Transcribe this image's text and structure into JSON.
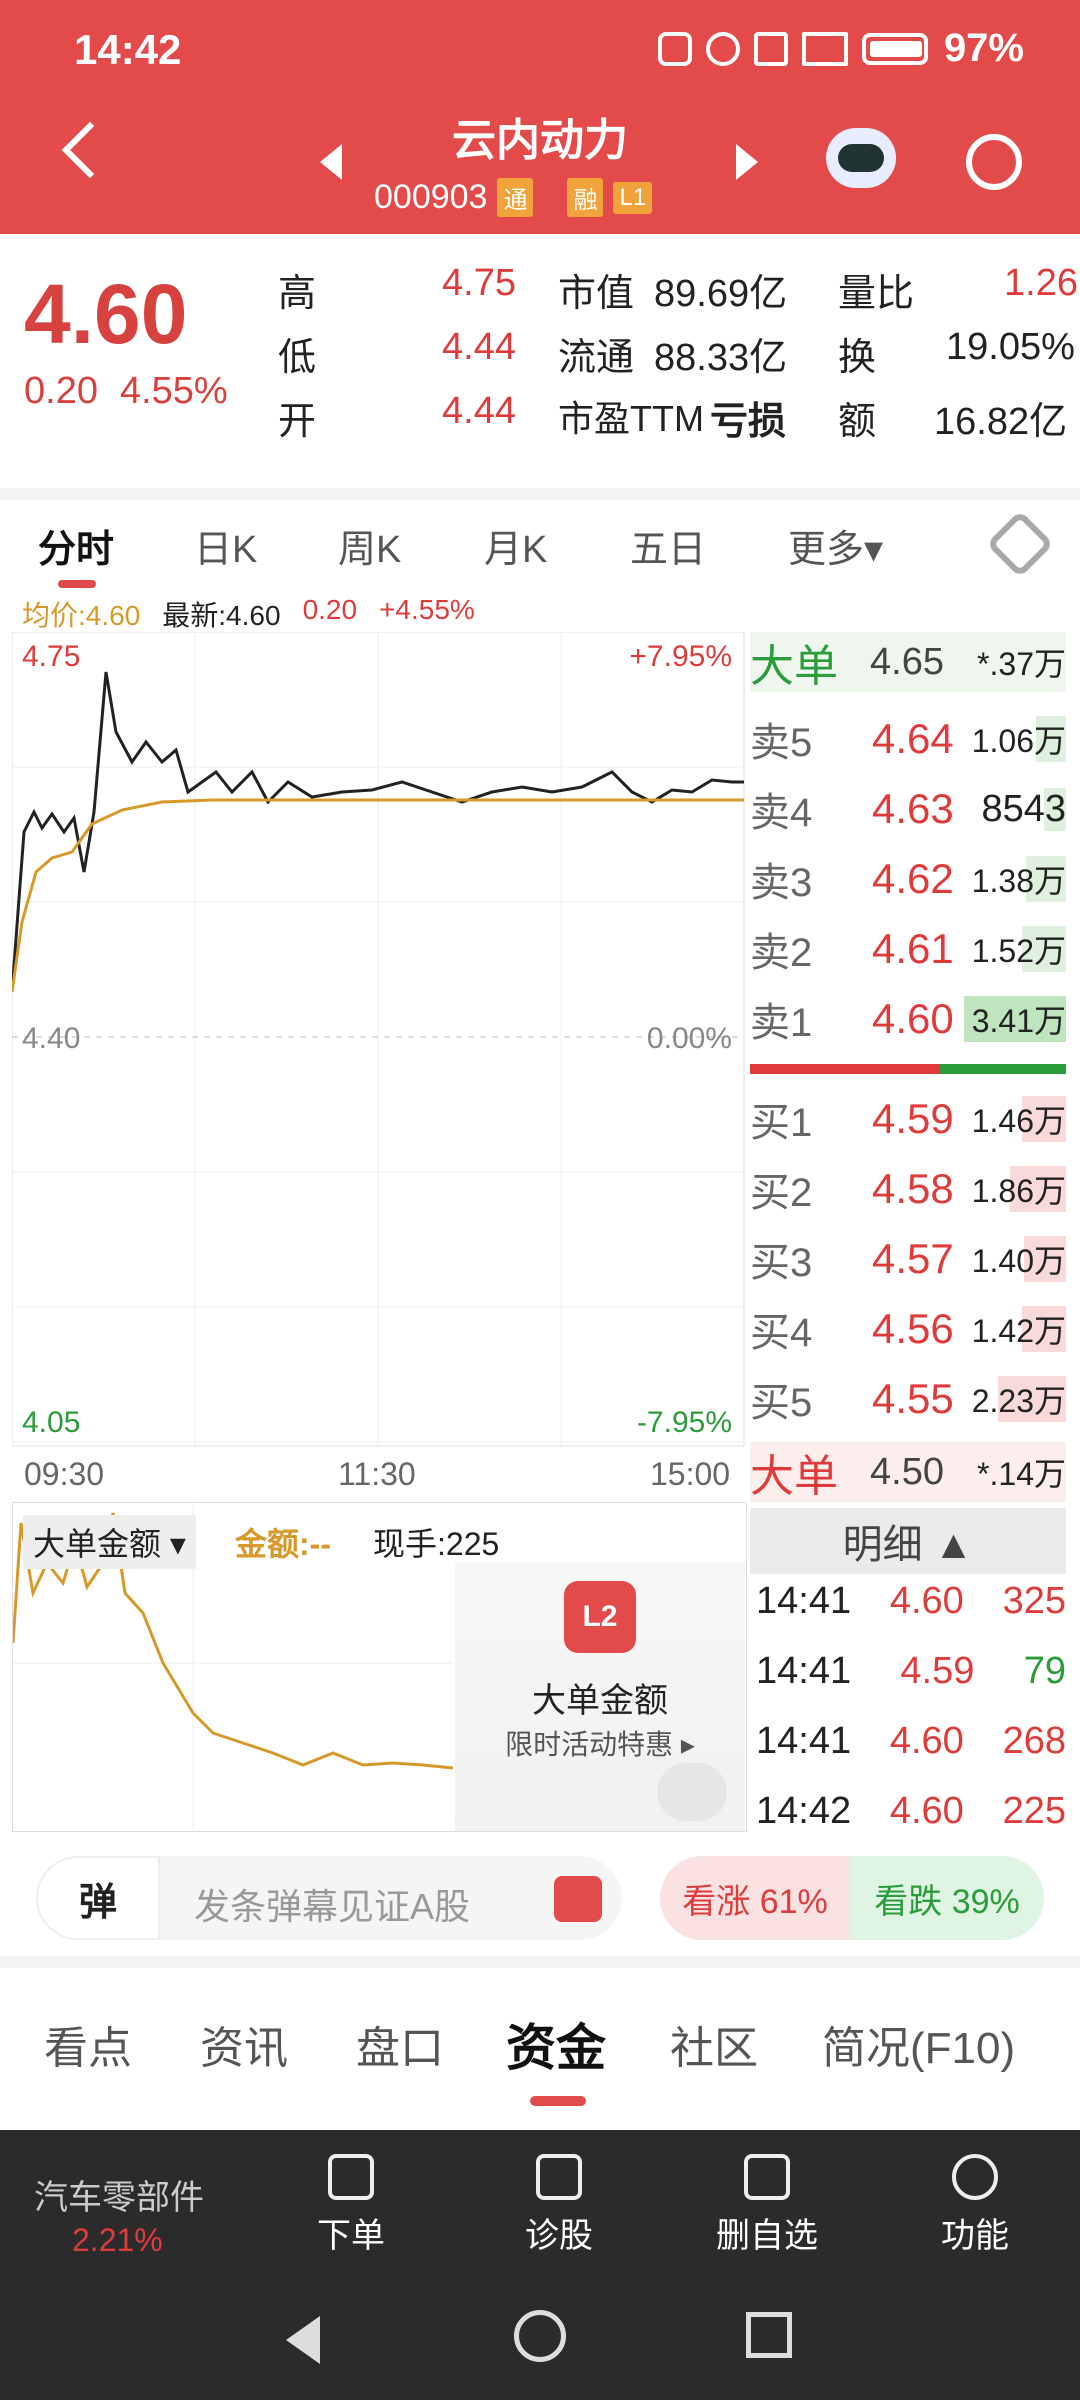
{
  "status": {
    "time": "14:42",
    "battery": "97%"
  },
  "header": {
    "title": "云内动力",
    "code": "000903",
    "tags": [
      "通",
      "融",
      "L1"
    ]
  },
  "quote": {
    "price": "4.60",
    "change": "0.20",
    "change_pct": "4.55%",
    "high_label": "高",
    "high": "4.75",
    "low_label": "低",
    "low": "4.44",
    "open_label": "开",
    "open": "4.44",
    "mktcap_label": "市值",
    "mktcap": "89.69亿",
    "float_label": "流通",
    "float": "88.33亿",
    "pe_label": "市盈TTM",
    "pe": "亏损",
    "vol_ratio_label": "量比",
    "vol_ratio": "1.26",
    "turnover_label": "换",
    "turnover": "19.05%",
    "amount_label": "额",
    "amount": "16.82亿"
  },
  "tabs": [
    "分时",
    "日K",
    "周K",
    "月K",
    "五日",
    "更多▾"
  ],
  "avg_line": {
    "avg": "均价:4.60",
    "latest": "最新:4.60",
    "chg": "0.20",
    "pct": "+4.55%"
  },
  "chart": {
    "y_top": "4.75",
    "y_mid": "4.40",
    "y_bot": "4.05",
    "pct_top": "+7.95%",
    "pct_mid": "0.00%",
    "pct_bot": "-7.95%",
    "x_labels": [
      "09:30",
      "11:30",
      "15:00"
    ]
  },
  "depth": {
    "big_top": {
      "label": "大单",
      "price": "4.65",
      "qty": "*.37万"
    },
    "asks": [
      {
        "label": "卖5",
        "price": "4.64",
        "qty": "1.06万"
      },
      {
        "label": "卖4",
        "price": "4.63",
        "qty": "8543"
      },
      {
        "label": "卖3",
        "price": "4.62",
        "qty": "1.38万"
      },
      {
        "label": "卖2",
        "price": "4.61",
        "qty": "1.52万"
      },
      {
        "label": "卖1",
        "price": "4.60",
        "qty": "3.41万"
      }
    ],
    "bids": [
      {
        "label": "买1",
        "price": "4.59",
        "qty": "1.46万"
      },
      {
        "label": "买2",
        "price": "4.58",
        "qty": "1.86万"
      },
      {
        "label": "买3",
        "price": "4.57",
        "qty": "1.40万"
      },
      {
        "label": "买4",
        "price": "4.56",
        "qty": "1.42万"
      },
      {
        "label": "买5",
        "price": "4.55",
        "qty": "2.23万"
      }
    ],
    "big_bottom": {
      "label": "大单",
      "price": "4.50",
      "qty": "*.14万"
    }
  },
  "detail": {
    "header": "明细 ▲",
    "rows": [
      {
        "time": "14:41",
        "price": "4.60",
        "qty": "325"
      },
      {
        "time": "14:41",
        "price": "4.59",
        "qty": "79"
      },
      {
        "time": "14:41",
        "price": "4.60",
        "qty": "268"
      },
      {
        "time": "14:42",
        "price": "4.60",
        "qty": "225"
      }
    ]
  },
  "lower_chart": {
    "selector": "大单金额 ▾",
    "amount": "金额:--",
    "now": "现手:225",
    "promo_title": "大单金额",
    "promo_sub": "限时活动特惠 ▸",
    "badge": "L2"
  },
  "danmu": {
    "icon": "弹",
    "placeholder": "发条弹幕见证A股"
  },
  "sentiment": {
    "up": "看涨 61%",
    "down": "看跌 39%"
  },
  "info_tabs": [
    "看点",
    "资讯",
    "盘口",
    "资金",
    "社区",
    "简况(F10)"
  ],
  "bottom": {
    "sector": "汽车零部件",
    "sector_pct": "2.21%",
    "items": [
      "下单",
      "诊股",
      "删自选",
      "功能"
    ]
  }
}
